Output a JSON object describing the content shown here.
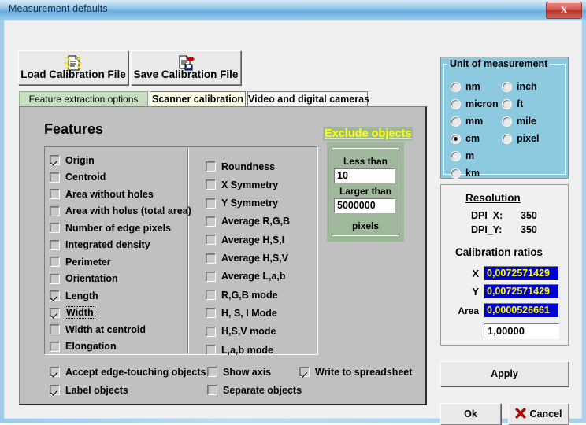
{
  "window": {
    "title": "Measurement defaults",
    "close_label": "X",
    "close_icon": "close-icon"
  },
  "toolbar": {
    "load_label": "Load Calibration File",
    "load_icon": "load-file-icon",
    "save_label": "Save Calibration File",
    "save_icon": "save-file-icon"
  },
  "tabs": [
    {
      "label": "Feature extraction options",
      "active": true
    },
    {
      "label": "Scanner calibration",
      "active": false
    },
    {
      "label": "Video and digital cameras",
      "active": false
    }
  ],
  "features": {
    "heading": "Features",
    "exclude_heading": "Exclude objects",
    "left_column": [
      {
        "label": "Origin",
        "checked": true,
        "focused": false
      },
      {
        "label": "Centroid",
        "checked": false,
        "focused": false
      },
      {
        "label": "Area without holes",
        "checked": false,
        "focused": false
      },
      {
        "label": "Area with holes (total area)",
        "checked": false,
        "focused": false
      },
      {
        "label": "Number of edge pixels",
        "checked": false,
        "focused": false
      },
      {
        "label": "Integrated density",
        "checked": false,
        "focused": false
      },
      {
        "label": "Perimeter",
        "checked": false,
        "focused": false
      },
      {
        "label": "Orientation",
        "checked": false,
        "focused": false
      },
      {
        "label": "Length",
        "checked": true,
        "focused": false
      },
      {
        "label": "Width",
        "checked": true,
        "focused": true
      },
      {
        "label": "Width at centroid",
        "checked": false,
        "focused": false
      },
      {
        "label": "Elongation",
        "checked": false,
        "focused": false
      }
    ],
    "right_column": [
      {
        "label": "Roundness",
        "checked": false
      },
      {
        "label": "X Symmetry",
        "checked": false
      },
      {
        "label": "Y Symmetry",
        "checked": false
      },
      {
        "label": "Average R,G,B",
        "checked": false
      },
      {
        "label": "Average H,S,I",
        "checked": false
      },
      {
        "label": "Average H,S,V",
        "checked": false
      },
      {
        "label": "Average L,a,b",
        "checked": false
      },
      {
        "label": "R,G,B mode",
        "checked": false
      },
      {
        "label": "H, S, I Mode",
        "checked": false
      },
      {
        "label": "H,S,V mode",
        "checked": false
      },
      {
        "label": "L,a,b mode",
        "checked": false
      }
    ],
    "bottom_options": [
      {
        "label": "Accept edge-touching objects",
        "checked": true
      },
      {
        "label": "Label objects",
        "checked": true
      },
      {
        "label": "Show axis",
        "checked": false
      },
      {
        "label": "Separate objects",
        "checked": false
      },
      {
        "label": "Write to spreadsheet",
        "checked": true
      }
    ]
  },
  "exclude": {
    "less_than_label": "Less than",
    "less_than_value": "10",
    "larger_than_label": "Larger than",
    "larger_than_value": "5000000",
    "units_label": "pixels"
  },
  "unit": {
    "group_title": "Unit of measurement",
    "options": [
      {
        "label": "nm",
        "selected": false
      },
      {
        "label": "micron",
        "selected": false
      },
      {
        "label": "mm",
        "selected": false
      },
      {
        "label": "cm",
        "selected": true
      },
      {
        "label": "m",
        "selected": false
      },
      {
        "label": "km",
        "selected": false
      },
      {
        "label": "inch",
        "selected": false
      },
      {
        "label": "ft",
        "selected": false
      },
      {
        "label": "mile",
        "selected": false
      },
      {
        "label": "pixel",
        "selected": false
      }
    ]
  },
  "resolution": {
    "heading": "Resolution",
    "dpi_x_label": "DPI_X:",
    "dpi_x_value": "350",
    "dpi_y_label": "DPI_Y:",
    "dpi_y_value": "350"
  },
  "calibration": {
    "heading": "Calibration ratios",
    "x_label": "X",
    "x_value": "0,0072571429",
    "y_label": "Y",
    "y_value": "0,0072571429",
    "area_label": "Area",
    "area_value": "0,0000526661",
    "scale_value": "1,00000"
  },
  "actions": {
    "apply_label": "Apply",
    "ok_label": "Ok",
    "cancel_label": "Cancel",
    "cancel_icon": "red-x-icon"
  },
  "colors": {
    "titlebar": "#7fbbe4",
    "dialog_face": "#c0c0c0",
    "active_tab": "#c6ddc2",
    "scanner_tab": "#fdfbe3",
    "exclude_panel": "#9fb79b",
    "unit_panel": "#8ecadf",
    "calibration_field_bg": "#0000cc",
    "calibration_field_fg": "#ffff00",
    "close_button": "#b92f27"
  }
}
